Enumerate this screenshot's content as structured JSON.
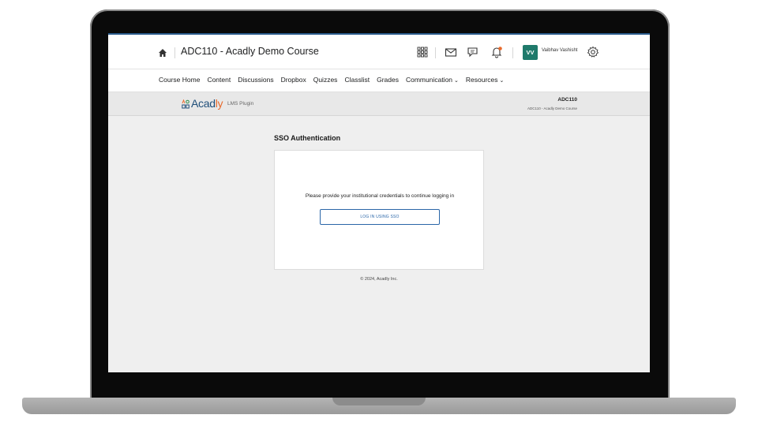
{
  "topbar": {
    "course_title": "ADC110 - Acadly Demo Course",
    "user_initials": "VV",
    "user_name": "Vaibhav Vashisht",
    "avatar_color": "#1f7a6b",
    "notification_dot_color": "#e86a2c",
    "icons": [
      "home-icon",
      "waffle-grid-icon",
      "mail-icon",
      "chat-icon",
      "bell-icon",
      "gear-icon"
    ]
  },
  "navbar": {
    "items": [
      {
        "label": "Course Home",
        "dropdown": false
      },
      {
        "label": "Content",
        "dropdown": false
      },
      {
        "label": "Discussions",
        "dropdown": false
      },
      {
        "label": "Dropbox",
        "dropdown": false
      },
      {
        "label": "Quizzes",
        "dropdown": false
      },
      {
        "label": "Classlist",
        "dropdown": false
      },
      {
        "label": "Grades",
        "dropdown": false
      },
      {
        "label": "Communication",
        "dropdown": true
      },
      {
        "label": "Resources",
        "dropdown": true
      }
    ]
  },
  "plugin": {
    "logo_main": "Acad",
    "logo_accent": "ly",
    "label": "LMS Plugin",
    "course_code": "ADC110",
    "course_name": "ADC110 - Acadly Demo Course",
    "brand_color": "#1f4e79",
    "accent_color": "#e86a2c"
  },
  "sso": {
    "heading": "SSO Authentication",
    "message": "Please provide your institutional credentials to continue logging in",
    "button_label": "LOG IN USING SSO"
  },
  "footer": {
    "copyright": "© 2024, Acadly Inc."
  }
}
